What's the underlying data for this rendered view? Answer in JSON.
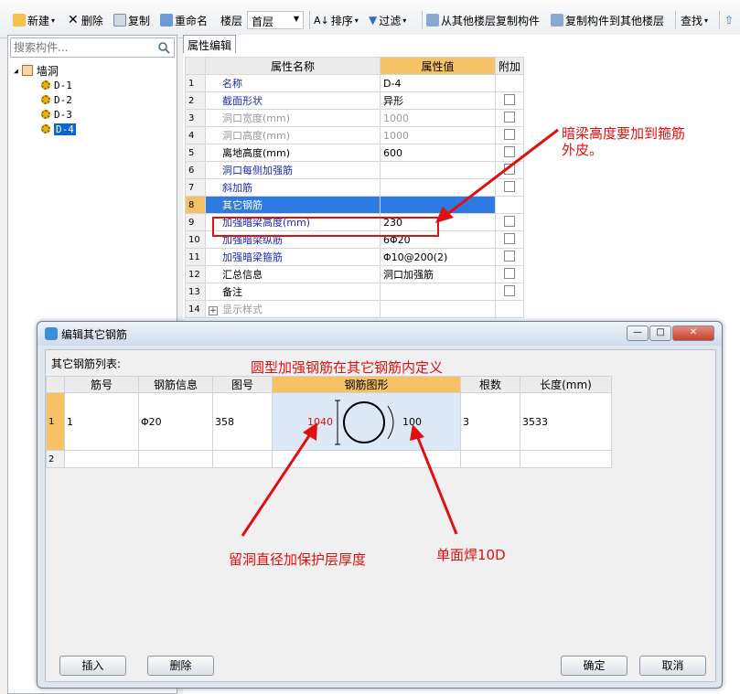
{
  "toolbar": {
    "new": "新建",
    "delete": "删除",
    "copy": "复制",
    "rename": "重命名",
    "floor_label": "楼层",
    "floor_value": "首层",
    "sort": "排序",
    "filter": "过滤",
    "copy_from_floor": "从其他楼层复制构件",
    "copy_to_floor": "复制构件到其他楼层",
    "find": "查找"
  },
  "tree": {
    "search_placeholder": "搜索构件...",
    "root": "墙洞",
    "items": [
      "D-1",
      "D-2",
      "D-3",
      "D-4"
    ]
  },
  "panel": {
    "tab": "属性编辑",
    "headers": {
      "name": "属性名称",
      "value": "属性值",
      "extra": "附加"
    },
    "rows": [
      {
        "n": "1",
        "name": "名称",
        "value": "D-4"
      },
      {
        "n": "2",
        "name": "截面形状",
        "value": "异形"
      },
      {
        "n": "3",
        "name": "洞口宽度(mm)",
        "value": "1000"
      },
      {
        "n": "4",
        "name": "洞口高度(mm)",
        "value": "1000"
      },
      {
        "n": "5",
        "name": "离地高度(mm)",
        "value": "600"
      },
      {
        "n": "6",
        "name": "洞口每侧加强筋",
        "value": ""
      },
      {
        "n": "7",
        "name": "斜加筋",
        "value": ""
      },
      {
        "n": "8",
        "name": "其它钢筋",
        "value": ""
      },
      {
        "n": "9",
        "name": "加强暗梁高度(mm)",
        "value": "230"
      },
      {
        "n": "10",
        "name": "加强暗梁纵筋",
        "value": "6Φ20"
      },
      {
        "n": "11",
        "name": "加强暗梁箍筋",
        "value": "Φ10@200(2)"
      },
      {
        "n": "12",
        "name": "汇总信息",
        "value": "洞口加强筋"
      },
      {
        "n": "13",
        "name": "备注",
        "value": ""
      },
      {
        "n": "14",
        "name": "显示样式",
        "value": ""
      }
    ]
  },
  "annotations": {
    "beam_height_1": "暗梁高度要加到箍筋",
    "beam_height_2": "外皮。",
    "circle_defined": "圆型加强钢筋在其它钢筋内定义",
    "diameter": "留洞直径加保护层厚度",
    "weld": "单面焊10D"
  },
  "dialog": {
    "title": "编辑其它钢筋",
    "list_label": "其它钢筋列表:",
    "headers": {
      "no": "筋号",
      "info": "钢筋信息",
      "fig_no": "图号",
      "shape": "钢筋图形",
      "count": "根数",
      "length": "长度(mm)"
    },
    "rows": [
      {
        "n": "1",
        "no": "1",
        "info": "Φ20",
        "fig_no": "358",
        "dim_left": "1040",
        "dim_right": "100",
        "count": "3",
        "length": "3533"
      },
      {
        "n": "2",
        "no": "",
        "info": "",
        "fig_no": "",
        "dim_left": "",
        "dim_right": "",
        "count": "",
        "length": ""
      }
    ],
    "insert": "插入",
    "remove": "删除",
    "ok": "确定",
    "cancel": "取消"
  },
  "colors": {
    "annotation": "#e01010",
    "selection": "#0a64d6",
    "header_value": "#f7c266"
  }
}
